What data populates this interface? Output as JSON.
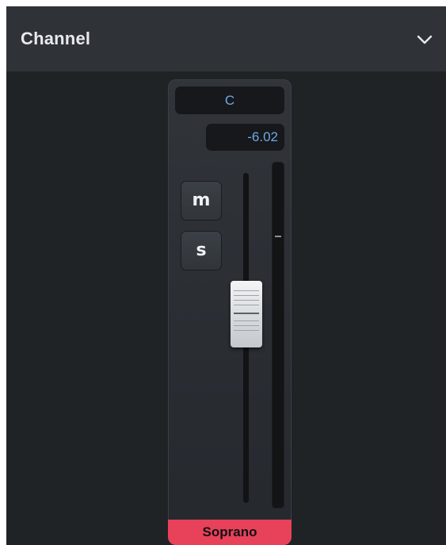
{
  "panel": {
    "title": "Channel",
    "collapse_icon": "chevron-down-icon"
  },
  "channel": {
    "name": "C",
    "volume": "-6.02",
    "mute_label": "m",
    "solo_label": "s",
    "player_name": "Soprano",
    "player_color": "#e8415a",
    "accent_text_color": "#6fa8e6"
  }
}
